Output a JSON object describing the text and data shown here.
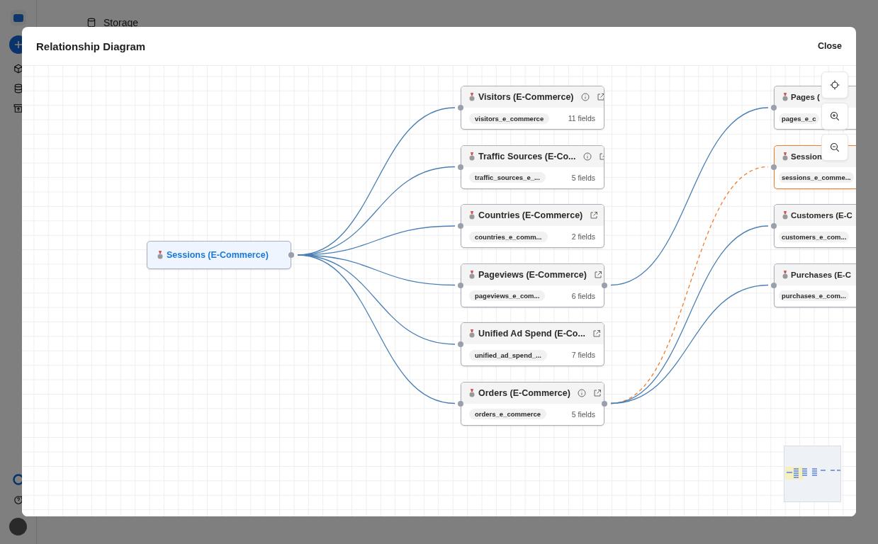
{
  "background": {
    "section_title": "Storage"
  },
  "dialog": {
    "title": "Relationship Diagram",
    "close_label": "Close"
  },
  "root_node": {
    "title": "Sessions (E-Commerce)"
  },
  "related_nodes": [
    {
      "title": "Visitors (E-Commerce)",
      "table": "visitors_e_commerce",
      "fields": "11 fields",
      "info": true
    },
    {
      "title": "Traffic Sources (E-Co...",
      "table": "traffic_sources_e_...",
      "fields": "5 fields",
      "info": true
    },
    {
      "title": "Countries (E-Commerce)",
      "table": "countries_e_comm...",
      "fields": "2 fields",
      "info": false
    },
    {
      "title": "Pageviews (E-Commerce)",
      "table": "pageviews_e_com...",
      "fields": "6 fields",
      "info": false,
      "linked": [
        {
          "title": "Pages (",
          "table": "pages_e_c",
          "highlighted": false
        }
      ]
    },
    {
      "title": "Unified Ad Spend (E-Co...",
      "table": "unified_ad_spend_...",
      "fields": "7 fields",
      "info": false
    },
    {
      "title": "Orders (E-Commerce)",
      "table": "orders_e_commerce",
      "fields": "5 fields",
      "info": true,
      "linked": [
        {
          "title": "Session",
          "table": "sessions_e_comme...",
          "highlighted": true
        },
        {
          "title": "Customers (E-C",
          "table": "customers_e_com...",
          "highlighted": false
        },
        {
          "title": "Purchases (E-C",
          "table": "purchases_e_com...",
          "highlighted": false
        }
      ]
    }
  ]
}
